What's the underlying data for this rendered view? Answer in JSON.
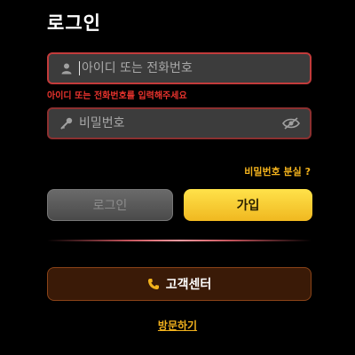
{
  "page": {
    "title": "로그인"
  },
  "login_form": {
    "id_field": {
      "placeholder": "아이디 또는 전화번호",
      "value": "",
      "icon": "user-icon"
    },
    "id_error": "아이디 또는 전화번호를 입력해주세요",
    "password_field": {
      "placeholder": "비밀번호",
      "value": "",
      "icon": "key-icon",
      "toggle_icon": "eye-off-icon"
    },
    "forgot_password": "비밀번호 분실 ?",
    "login_button": "로그인",
    "signup_button": "가입",
    "support_button": {
      "label": "고객센터",
      "icon": "phone-icon"
    },
    "visit_link": "방문하기"
  },
  "colors": {
    "background": "#000000",
    "accent": "#f2b21d",
    "error": "#e8332d",
    "signup": "#f7c829",
    "support_bg": "#3a1a07"
  }
}
